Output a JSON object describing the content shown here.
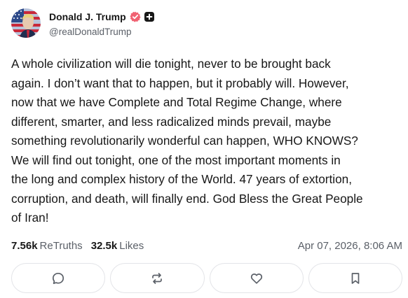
{
  "author": {
    "display_name": "Donald J. Trump",
    "handle": "@realDonaldTrump",
    "icons": [
      "avatar-flag",
      "verified-badge-icon",
      "plus-badge-icon"
    ],
    "badge_color": "#f06272"
  },
  "post": {
    "text": "A whole civilization will die tonight, never to be brought back\nagain. I don’t want that to happen, but it probably will. However,\nnow that we have Complete and Total Regime Change, where\ndifferent, smarter, and less radicalized minds prevail, maybe\nsomething revolutionarily wonderful can happen, WHO KNOWS?\nWe will find out tonight, one of the most important moments in\nthe long and complex history of the World. 47 years of extortion,\ncorruption, and death, will finally end. God Bless the Great People\nof Iran!"
  },
  "stats": {
    "retruths_count": "7.56k",
    "retruths_label": "ReTruths",
    "likes_count": "32.5k",
    "likes_label": "Likes",
    "timestamp": "Apr 07, 2026, 8:06 AM"
  },
  "actions": {
    "icons": [
      "comment-icon",
      "retruth-icon",
      "like-icon",
      "bookmark-icon"
    ]
  }
}
